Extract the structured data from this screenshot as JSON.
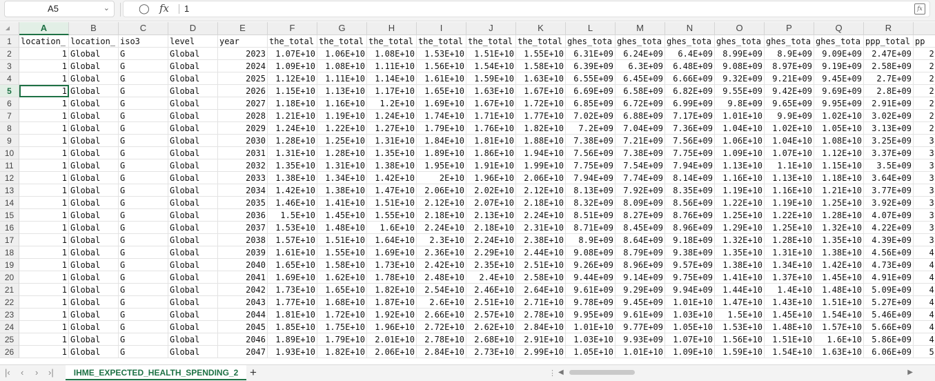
{
  "formula_bar": {
    "name_box": "A5",
    "formula_value": "1",
    "fx_label": "fx"
  },
  "columns": [
    "A",
    "B",
    "C",
    "D",
    "E",
    "F",
    "G",
    "H",
    "I",
    "J",
    "K",
    "L",
    "M",
    "N",
    "O",
    "P",
    "Q",
    "R",
    ""
  ],
  "selected_column": "A",
  "selected_row": "5",
  "rows": [
    {
      "num": "1",
      "cells": [
        "location_",
        "location_",
        "iso3",
        "level",
        "year",
        "the_total",
        "the_total",
        "the_total",
        "the_total",
        "the_total",
        "the_total",
        "ghes_tota",
        "ghes_tota",
        "ghes_tota",
        "ghes_tota",
        "ghes_tota",
        "ghes_tota",
        "ppp_total",
        "pp"
      ]
    },
    {
      "num": "2",
      "cells": [
        "1",
        "Global",
        "G",
        "Global",
        "2023",
        "1.07E+10",
        "1.06E+10",
        "1.08E+10",
        "1.53E+10",
        "1.51E+10",
        "1.55E+10",
        "6.31E+09",
        "6.24E+09",
        "6.4E+09",
        "8.99E+09",
        "8.9E+09",
        "9.09E+09",
        "2.47E+09",
        "2."
      ]
    },
    {
      "num": "3",
      "cells": [
        "1",
        "Global",
        "G",
        "Global",
        "2024",
        "1.09E+10",
        "1.08E+10",
        "1.11E+10",
        "1.56E+10",
        "1.54E+10",
        "1.58E+10",
        "6.39E+09",
        "6.3E+09",
        "6.48E+09",
        "9.08E+09",
        "8.97E+09",
        "9.19E+09",
        "2.58E+09",
        "2."
      ]
    },
    {
      "num": "4",
      "cells": [
        "1",
        "Global",
        "G",
        "Global",
        "2025",
        "1.12E+10",
        "1.11E+10",
        "1.14E+10",
        "1.61E+10",
        "1.59E+10",
        "1.63E+10",
        "6.55E+09",
        "6.45E+09",
        "6.66E+09",
        "9.32E+09",
        "9.21E+09",
        "9.45E+09",
        "2.7E+09",
        "2."
      ]
    },
    {
      "num": "5",
      "cells": [
        "1",
        "Global",
        "G",
        "Global",
        "2026",
        "1.15E+10",
        "1.13E+10",
        "1.17E+10",
        "1.65E+10",
        "1.63E+10",
        "1.67E+10",
        "6.69E+09",
        "6.58E+09",
        "6.82E+09",
        "9.55E+09",
        "9.42E+09",
        "9.69E+09",
        "2.8E+09",
        "2."
      ]
    },
    {
      "num": "6",
      "cells": [
        "1",
        "Global",
        "G",
        "Global",
        "2027",
        "1.18E+10",
        "1.16E+10",
        "1.2E+10",
        "1.69E+10",
        "1.67E+10",
        "1.72E+10",
        "6.85E+09",
        "6.72E+09",
        "6.99E+09",
        "9.8E+09",
        "9.65E+09",
        "9.95E+09",
        "2.91E+09",
        "2."
      ]
    },
    {
      "num": "7",
      "cells": [
        "1",
        "Global",
        "G",
        "Global",
        "2028",
        "1.21E+10",
        "1.19E+10",
        "1.24E+10",
        "1.74E+10",
        "1.71E+10",
        "1.77E+10",
        "7.02E+09",
        "6.88E+09",
        "7.17E+09",
        "1.01E+10",
        "9.9E+09",
        "1.02E+10",
        "3.02E+09",
        "2."
      ]
    },
    {
      "num": "8",
      "cells": [
        "1",
        "Global",
        "G",
        "Global",
        "2029",
        "1.24E+10",
        "1.22E+10",
        "1.27E+10",
        "1.79E+10",
        "1.76E+10",
        "1.82E+10",
        "7.2E+09",
        "7.04E+09",
        "7.36E+09",
        "1.04E+10",
        "1.02E+10",
        "1.05E+10",
        "3.13E+09",
        "2."
      ]
    },
    {
      "num": "9",
      "cells": [
        "1",
        "Global",
        "G",
        "Global",
        "2030",
        "1.28E+10",
        "1.25E+10",
        "1.31E+10",
        "1.84E+10",
        "1.81E+10",
        "1.88E+10",
        "7.38E+09",
        "7.21E+09",
        "7.56E+09",
        "1.06E+10",
        "1.04E+10",
        "1.08E+10",
        "3.25E+09",
        "3."
      ]
    },
    {
      "num": "10",
      "cells": [
        "1",
        "Global",
        "G",
        "Global",
        "2031",
        "1.31E+10",
        "1.28E+10",
        "1.35E+10",
        "1.89E+10",
        "1.86E+10",
        "1.94E+10",
        "7.56E+09",
        "7.38E+09",
        "7.75E+09",
        "1.09E+10",
        "1.07E+10",
        "1.12E+10",
        "3.37E+09",
        "3."
      ]
    },
    {
      "num": "11",
      "cells": [
        "1",
        "Global",
        "G",
        "Global",
        "2032",
        "1.35E+10",
        "1.31E+10",
        "1.38E+10",
        "1.95E+10",
        "1.91E+10",
        "1.99E+10",
        "7.75E+09",
        "7.54E+09",
        "7.94E+09",
        "1.13E+10",
        "1.1E+10",
        "1.15E+10",
        "3.5E+09",
        "3."
      ]
    },
    {
      "num": "12",
      "cells": [
        "1",
        "Global",
        "G",
        "Global",
        "2033",
        "1.38E+10",
        "1.34E+10",
        "1.42E+10",
        "2E+10",
        "1.96E+10",
        "2.06E+10",
        "7.94E+09",
        "7.74E+09",
        "8.14E+09",
        "1.16E+10",
        "1.13E+10",
        "1.18E+10",
        "3.64E+09",
        "3."
      ]
    },
    {
      "num": "13",
      "cells": [
        "1",
        "Global",
        "G",
        "Global",
        "2034",
        "1.42E+10",
        "1.38E+10",
        "1.47E+10",
        "2.06E+10",
        "2.02E+10",
        "2.12E+10",
        "8.13E+09",
        "7.92E+09",
        "8.35E+09",
        "1.19E+10",
        "1.16E+10",
        "1.21E+10",
        "3.77E+09",
        "3."
      ]
    },
    {
      "num": "14",
      "cells": [
        "1",
        "Global",
        "G",
        "Global",
        "2035",
        "1.46E+10",
        "1.41E+10",
        "1.51E+10",
        "2.12E+10",
        "2.07E+10",
        "2.18E+10",
        "8.32E+09",
        "8.09E+09",
        "8.56E+09",
        "1.22E+10",
        "1.19E+10",
        "1.25E+10",
        "3.92E+09",
        "3."
      ]
    },
    {
      "num": "15",
      "cells": [
        "1",
        "Global",
        "G",
        "Global",
        "2036",
        "1.5E+10",
        "1.45E+10",
        "1.55E+10",
        "2.18E+10",
        "2.13E+10",
        "2.24E+10",
        "8.51E+09",
        "8.27E+09",
        "8.76E+09",
        "1.25E+10",
        "1.22E+10",
        "1.28E+10",
        "4.07E+09",
        "3."
      ]
    },
    {
      "num": "16",
      "cells": [
        "1",
        "Global",
        "G",
        "Global",
        "2037",
        "1.53E+10",
        "1.48E+10",
        "1.6E+10",
        "2.24E+10",
        "2.18E+10",
        "2.31E+10",
        "8.71E+09",
        "8.45E+09",
        "8.96E+09",
        "1.29E+10",
        "1.25E+10",
        "1.32E+10",
        "4.22E+09",
        "3."
      ]
    },
    {
      "num": "17",
      "cells": [
        "1",
        "Global",
        "G",
        "Global",
        "2038",
        "1.57E+10",
        "1.51E+10",
        "1.64E+10",
        "2.3E+10",
        "2.24E+10",
        "2.38E+10",
        "8.9E+09",
        "8.64E+09",
        "9.18E+09",
        "1.32E+10",
        "1.28E+10",
        "1.35E+10",
        "4.39E+09",
        "3."
      ]
    },
    {
      "num": "18",
      "cells": [
        "1",
        "Global",
        "G",
        "Global",
        "2039",
        "1.61E+10",
        "1.55E+10",
        "1.69E+10",
        "2.36E+10",
        "2.29E+10",
        "2.44E+10",
        "9.08E+09",
        "8.79E+09",
        "9.38E+09",
        "1.35E+10",
        "1.31E+10",
        "1.38E+10",
        "4.56E+09",
        "4."
      ]
    },
    {
      "num": "19",
      "cells": [
        "1",
        "Global",
        "G",
        "Global",
        "2040",
        "1.65E+10",
        "1.58E+10",
        "1.73E+10",
        "2.42E+10",
        "2.35E+10",
        "2.51E+10",
        "9.26E+09",
        "8.96E+09",
        "9.57E+09",
        "1.38E+10",
        "1.34E+10",
        "1.42E+10",
        "4.73E+09",
        "4."
      ]
    },
    {
      "num": "20",
      "cells": [
        "1",
        "Global",
        "G",
        "Global",
        "2041",
        "1.69E+10",
        "1.62E+10",
        "1.78E+10",
        "2.48E+10",
        "2.4E+10",
        "2.58E+10",
        "9.44E+09",
        "9.14E+09",
        "9.75E+09",
        "1.41E+10",
        "1.37E+10",
        "1.45E+10",
        "4.91E+09",
        "4."
      ]
    },
    {
      "num": "21",
      "cells": [
        "1",
        "Global",
        "G",
        "Global",
        "2042",
        "1.73E+10",
        "1.65E+10",
        "1.82E+10",
        "2.54E+10",
        "2.46E+10",
        "2.64E+10",
        "9.61E+09",
        "9.29E+09",
        "9.94E+09",
        "1.44E+10",
        "1.4E+10",
        "1.48E+10",
        "5.09E+09",
        "4."
      ]
    },
    {
      "num": "22",
      "cells": [
        "1",
        "Global",
        "G",
        "Global",
        "2043",
        "1.77E+10",
        "1.68E+10",
        "1.87E+10",
        "2.6E+10",
        "2.51E+10",
        "2.71E+10",
        "9.78E+09",
        "9.45E+09",
        "1.01E+10",
        "1.47E+10",
        "1.43E+10",
        "1.51E+10",
        "5.27E+09",
        "4."
      ]
    },
    {
      "num": "23",
      "cells": [
        "1",
        "Global",
        "G",
        "Global",
        "2044",
        "1.81E+10",
        "1.72E+10",
        "1.92E+10",
        "2.66E+10",
        "2.57E+10",
        "2.78E+10",
        "9.95E+09",
        "9.61E+09",
        "1.03E+10",
        "1.5E+10",
        "1.45E+10",
        "1.54E+10",
        "5.46E+09",
        "4."
      ]
    },
    {
      "num": "24",
      "cells": [
        "1",
        "Global",
        "G",
        "Global",
        "2045",
        "1.85E+10",
        "1.75E+10",
        "1.96E+10",
        "2.72E+10",
        "2.62E+10",
        "2.84E+10",
        "1.01E+10",
        "9.77E+09",
        "1.05E+10",
        "1.53E+10",
        "1.48E+10",
        "1.57E+10",
        "5.66E+09",
        "4."
      ]
    },
    {
      "num": "25",
      "cells": [
        "1",
        "Global",
        "G",
        "Global",
        "2046",
        "1.89E+10",
        "1.79E+10",
        "2.01E+10",
        "2.78E+10",
        "2.68E+10",
        "2.91E+10",
        "1.03E+10",
        "9.93E+09",
        "1.07E+10",
        "1.56E+10",
        "1.51E+10",
        "1.6E+10",
        "5.86E+09",
        "4."
      ]
    },
    {
      "num": "26",
      "cells": [
        "1",
        "Global",
        "G",
        "Global",
        "2047",
        "1.93E+10",
        "1.82E+10",
        "2.06E+10",
        "2.84E+10",
        "2.73E+10",
        "2.99E+10",
        "1.05E+10",
        "1.01E+10",
        "1.09E+10",
        "1.59E+10",
        "1.54E+10",
        "1.63E+10",
        "6.06E+09",
        "5."
      ]
    }
  ],
  "sheet_tabs": [
    {
      "label": "IHME_EXPECTED_HEALTH_SPENDING_2",
      "active": true
    }
  ],
  "colors": {
    "accent": "#1e7145",
    "header_bg": "#efefef",
    "grid_line": "#e3e3e3"
  },
  "icons": {
    "name_box_dropdown": "chevron-down-icon",
    "zoom": "zoom-icon",
    "fx": "fx-icon",
    "expand": "expand-formula-icon",
    "nav_first": "first-sheet-icon",
    "nav_prev": "prev-sheet-icon",
    "nav_next": "next-sheet-icon",
    "nav_last": "last-sheet-icon",
    "add_sheet": "plus-icon"
  }
}
